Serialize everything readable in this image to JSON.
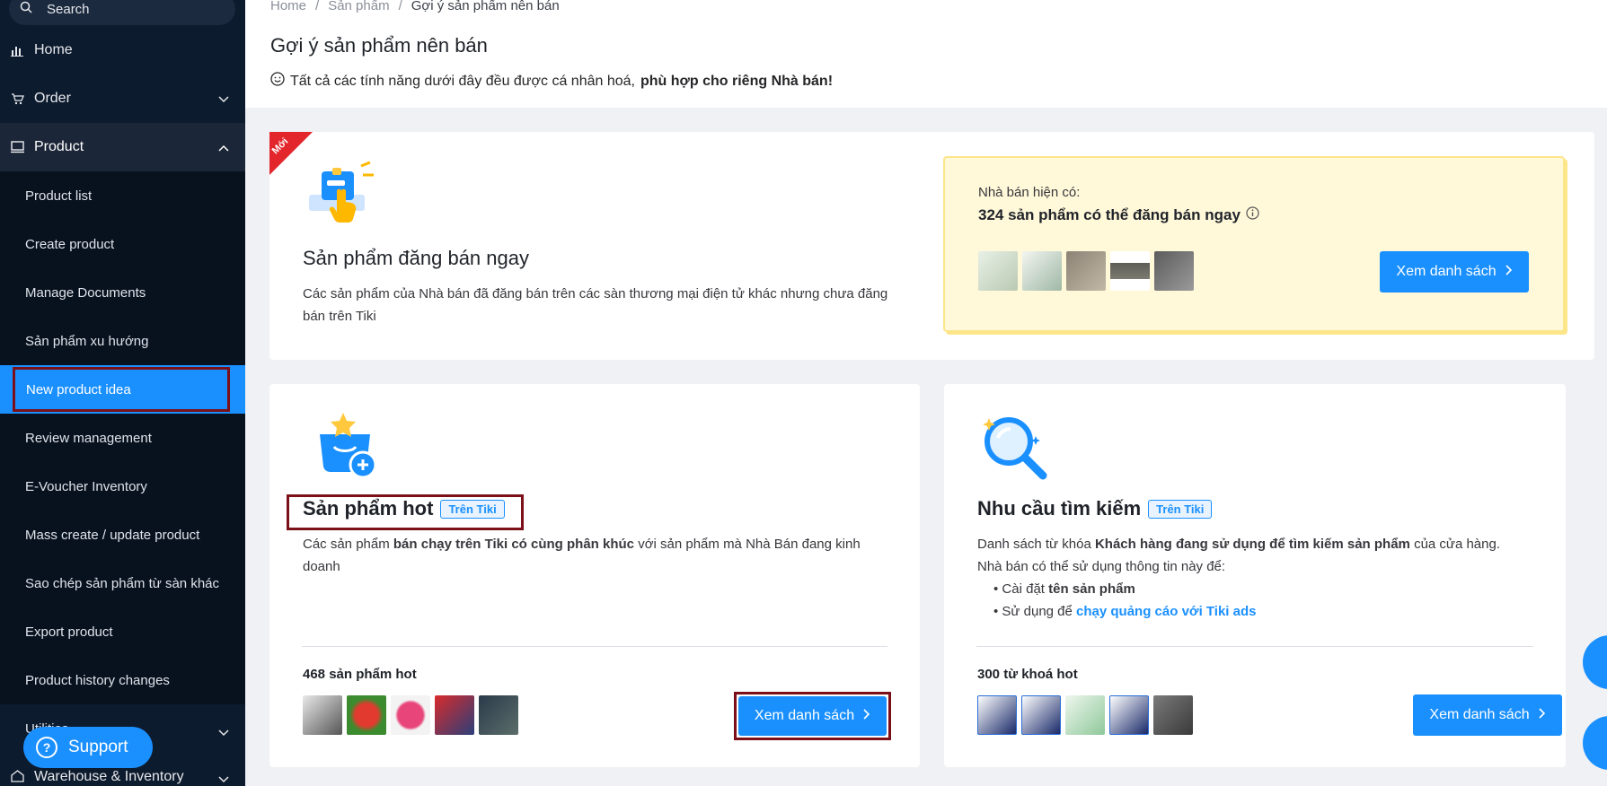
{
  "sidebar": {
    "search_label": "Search",
    "home": "Home",
    "order": "Order",
    "product": "Product",
    "sub_items": [
      "Product list",
      "Create product",
      "Manage Documents",
      "Sản phẩm xu hướng",
      "New product idea",
      "Review management",
      "E-Voucher Inventory",
      "Mass create / update product",
      "Sao chép sản phẩm từ sàn khác",
      "Export product",
      "Product history changes",
      "Utilities"
    ],
    "warehouse": "Warehouse & Inventory",
    "support": "Support"
  },
  "header": {
    "breadcrumb": [
      "Home",
      "Sản phẩm",
      "Gợi ý sản phẩm nên bán"
    ],
    "title": "Gợi ý sản phẩm nên bán",
    "subtitle_plain": "Tất cả các tính năng dưới đây đều được cá nhân hoá,",
    "subtitle_bold": "phù hợp cho riêng Nhà bán!"
  },
  "card_list_now": {
    "badge": "Mới",
    "title": "Sản phẩm đăng bán ngay",
    "desc": "Các sản phẩm của Nhà bán đã đăng bán trên các sàn thương mại điện tử khác nhưng chưa đăng bán trên Tiki",
    "available_label": "Nhà bán hiện có:",
    "available_count": "324 sản phẩm có thể đăng bán ngay",
    "button": "Xem danh sách"
  },
  "card_hot": {
    "title": "Sản phẩm hot",
    "tag": "Trên Tiki",
    "desc_1": "Các sản phẩm",
    "desc_bold": "bán chạy trên Tiki có cùng phân khúc",
    "desc_2": "với sản phẩm mà Nhà Bán đang kinh doanh",
    "count": "468 sản phẩm hot",
    "button": "Xem danh sách"
  },
  "card_search": {
    "title": "Nhu cầu tìm kiếm",
    "tag": "Trên Tiki",
    "desc_1": "Danh sách từ khóa",
    "desc_bold": "Khách hàng đang sử dụng để tìm kiếm sản phẩm",
    "desc_2": "của cửa hàng.",
    "desc_line2": "Nhà bán có thể sử dụng thông tin này để:",
    "bullet1_plain": "Cài đặt",
    "bullet1_bold": "tên sản phẩm",
    "bullet2_plain": "Sử dụng để",
    "bullet2_link": "chạy quảng cáo với Tiki ads",
    "count": "300 từ khoá hot",
    "button": "Xem danh sách"
  },
  "colors": {
    "accent": "#1a90ff",
    "sidebar": "#0d1b2e",
    "highlight_frame": "#7b1018",
    "new_badge": "#e3262c"
  }
}
